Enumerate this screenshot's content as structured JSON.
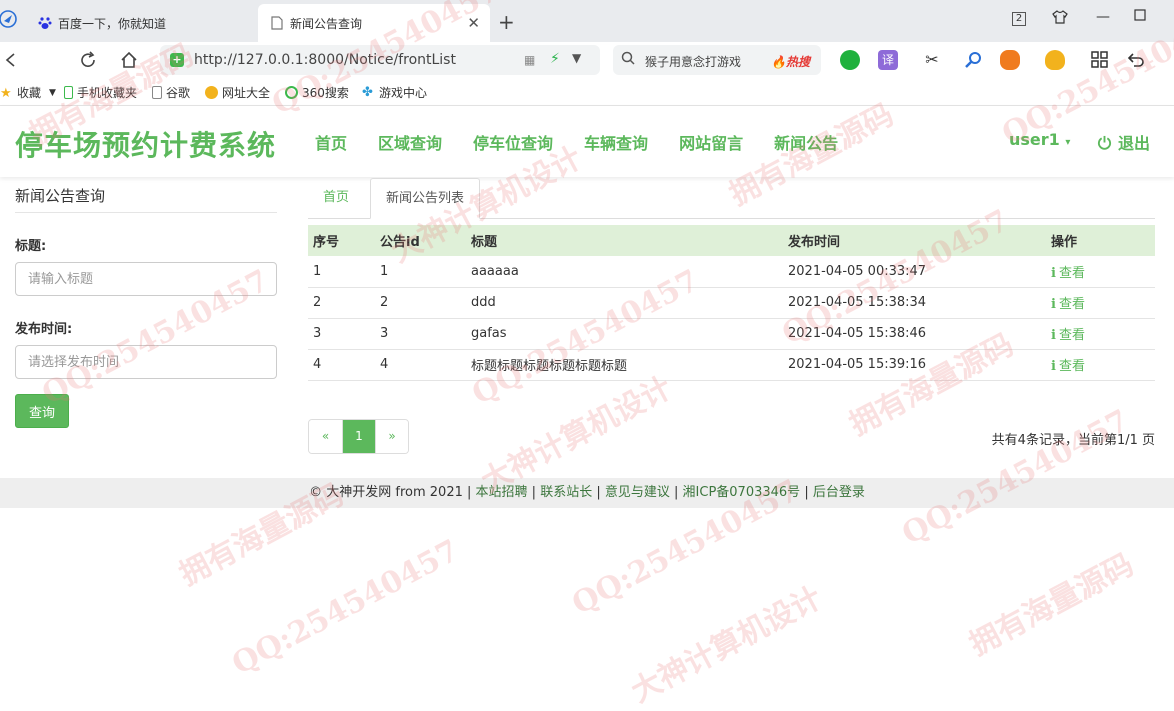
{
  "browser": {
    "tabs": [
      {
        "title": "百度一下，你就知道"
      },
      {
        "title": "新闻公告查询"
      }
    ],
    "url": "http://127.0.0.1:8000/Notice/frontList",
    "search_text": "猴子用意念打游戏",
    "search_badge": "热搜",
    "bookmarks": [
      "收藏",
      "手机收藏夹",
      "谷歌",
      "网址大全",
      "360搜索",
      "游戏中心"
    ],
    "tab_count": "2"
  },
  "site": {
    "brand": "停车场预约计费系统",
    "nav": [
      "首页",
      "区域查询",
      "停车位查询",
      "车辆查询",
      "网站留言",
      "新闻公告"
    ],
    "user": "user1",
    "logout": "退出"
  },
  "sidebar": {
    "title": "新闻公告查询",
    "title_label": "标题:",
    "title_placeholder": "请输入标题",
    "time_label": "发布时间:",
    "time_placeholder": "请选择发布时间",
    "query_button": "查询"
  },
  "content": {
    "tabs": [
      "首页",
      "新闻公告列表"
    ],
    "columns": [
      "序号",
      "公告id",
      "标题",
      "发布时间",
      "操作"
    ],
    "rows": [
      {
        "no": "1",
        "id": "1",
        "title": "aaaaaa",
        "time": "2021-04-05 00:33:47",
        "action": "查看"
      },
      {
        "no": "2",
        "id": "2",
        "title": "ddd",
        "time": "2021-04-05 15:38:34",
        "action": "查看"
      },
      {
        "no": "3",
        "id": "3",
        "title": "gafas",
        "time": "2021-04-05 15:38:46",
        "action": "查看"
      },
      {
        "no": "4",
        "id": "4",
        "title": "标题标题标题标题标题标题",
        "time": "2021-04-05 15:39:16",
        "action": "查看"
      }
    ],
    "pager": {
      "prev": "«",
      "current": "1",
      "next": "»"
    },
    "page_info": "共有4条记录，当前第1/1 页"
  },
  "footer": {
    "copyright": "© 大神开发网 from 2021",
    "links": [
      "本站招聘",
      "联系站长",
      "意见与建议",
      "湘ICP备0703346号",
      "后台登录"
    ]
  },
  "watermarks": [
    "QQ:254540457",
    "拥有海量源码",
    "大神计算机设计"
  ],
  "colors": {
    "accent": "#5cb85c",
    "header_row": "#dff0d8"
  }
}
